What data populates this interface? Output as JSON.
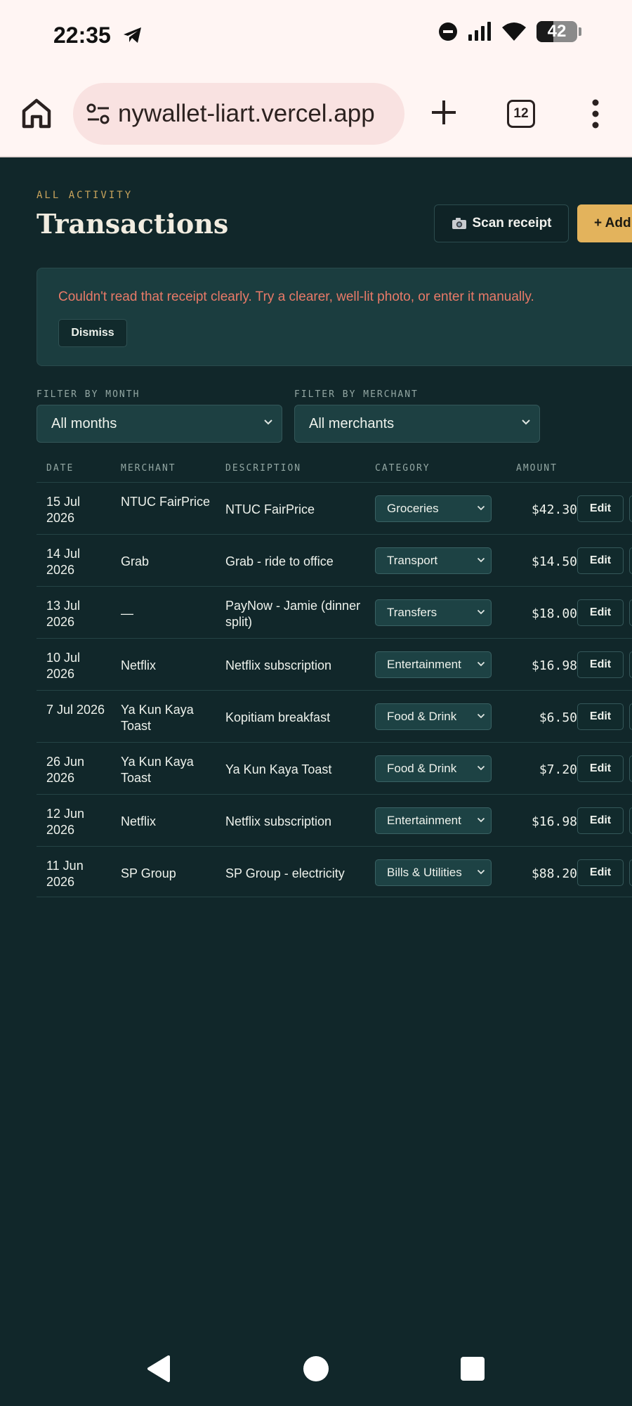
{
  "status_bar": {
    "time": "22:35",
    "battery_level": "42",
    "battery_fraction": 0.42,
    "icons": [
      "telegram-icon",
      "dnd-icon",
      "signal-icon",
      "wifi-icon",
      "battery-icon"
    ]
  },
  "browser": {
    "url": "nywallet-liart.vercel.app",
    "tab_count": "12",
    "icons": [
      "home-icon",
      "site-settings-icon",
      "new-tab-icon",
      "tabs-icon",
      "menu-icon"
    ]
  },
  "header": {
    "eyebrow": "ALL ACTIVITY",
    "title": "Transactions",
    "scan_label": "Scan receipt",
    "scan_icon": "camera-icon",
    "add_label": "+ Add"
  },
  "error": {
    "message": "Couldn't read that receipt clearly. Try a clearer, well-lit photo, or enter it manually.",
    "dismiss_label": "Dismiss"
  },
  "filters": {
    "month_label": "FILTER BY MONTH",
    "month_value": "All months",
    "merchant_label": "FILTER BY MERCHANT",
    "merchant_value": "All merchants"
  },
  "table": {
    "headers": {
      "date": "DATE",
      "merchant": "MERCHANT",
      "description": "DESCRIPTION",
      "category": "CATEGORY",
      "amount": "AMOUNT"
    },
    "edit_label": "Edit",
    "rows": [
      {
        "date": "15 Jul 2026",
        "merchant": "NTUC FairPrice",
        "description": "NTUC FairPrice",
        "category": "Groceries",
        "amount": "$42.30"
      },
      {
        "date": "14 Jul 2026",
        "merchant": "Grab",
        "description": "Grab - ride to office",
        "category": "Transport",
        "amount": "$14.50"
      },
      {
        "date": "13 Jul 2026",
        "merchant": "—",
        "description": "PayNow - Jamie (dinner split)",
        "category": "Transfers",
        "amount": "$18.00"
      },
      {
        "date": "10 Jul 2026",
        "merchant": "Netflix",
        "description": "Netflix subscription",
        "category": "Entertainment",
        "amount": "$16.98"
      },
      {
        "date": "7 Jul 2026",
        "merchant": "Ya Kun Kaya Toast",
        "description": "Kopitiam breakfast",
        "category": "Food & Drink",
        "amount": "$6.50"
      },
      {
        "date": "26 Jun 2026",
        "merchant": "Ya Kun Kaya Toast",
        "description": "Ya Kun Kaya Toast",
        "category": "Food & Drink",
        "amount": "$7.20"
      },
      {
        "date": "12 Jun 2026",
        "merchant": "Netflix",
        "description": "Netflix subscription",
        "category": "Entertainment",
        "amount": "$16.98"
      },
      {
        "date": "11 Jun 2026",
        "merchant": "SP Group",
        "description": "SP Group - electricity",
        "category": "Bills & Utilities",
        "amount": "$88.20"
      }
    ]
  },
  "colors": {
    "background": "#11272a",
    "accent": "#e3b35c",
    "error": "#e97a68",
    "eyebrow": "#c9a45c"
  }
}
